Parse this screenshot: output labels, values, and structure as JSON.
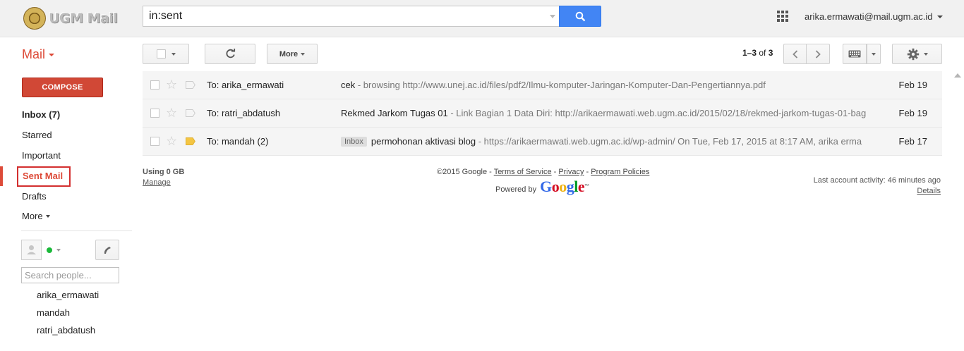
{
  "header": {
    "logo_text": "UGM Mail",
    "search_value": "in:sent",
    "account_email": "arika.ermawati@mail.ugm.ac.id"
  },
  "toolbar": {
    "mail_label": "Mail",
    "more_label": "More",
    "pager_range": "1–3",
    "pager_of": "of",
    "pager_total": "3"
  },
  "sidebar": {
    "compose_label": "COMPOSE",
    "items": [
      {
        "label": "Inbox (7)",
        "bold": true
      },
      {
        "label": "Starred"
      },
      {
        "label": "Important"
      },
      {
        "label": "Sent Mail",
        "active": true
      },
      {
        "label": "Drafts"
      },
      {
        "label": "More"
      }
    ],
    "people_search_placeholder": "Search people...",
    "contacts": [
      "arika_ermawati",
      "mandah",
      "ratri_abdatush"
    ]
  },
  "messages": [
    {
      "to": "To: arika_ermawati",
      "subject": "cek",
      "snippet": " - browsing http://www.unej.ac.id/files/pdf2/Ilmu-komputer-Jaringan-Komputer-Dan-Pengertiannya.pdf",
      "label": "",
      "date": "Feb 19",
      "important": false
    },
    {
      "to": "To: ratri_abdatush",
      "subject": "Rekmed Jarkom Tugas 01",
      "snippet": " - Link Bagian 1 Data Diri: http://arikaermawati.web.ugm.ac.id/2015/02/18/rekmed-jarkom-tugas-01-bag",
      "label": "",
      "date": "Feb 19",
      "important": false
    },
    {
      "to": "To: mandah (2)",
      "subject": "permohonan aktivasi blog",
      "snippet": " - https://arikaermawati.web.ugm.ac.id/wp-admin/ On Tue, Feb 17, 2015 at 8:17 AM, arika erma",
      "label": "Inbox",
      "date": "Feb 17",
      "important": true
    }
  ],
  "footer": {
    "usage": "Using 0 GB",
    "manage": "Manage",
    "copyright": "©2015 Google - ",
    "terms": "Terms of Service",
    "sep1": " - ",
    "privacy": "Privacy",
    "sep2": " - ",
    "policies": "Program Policies",
    "powered_by": "Powered by",
    "last_activity": "Last account activity: 46 minutes ago",
    "details": "Details"
  },
  "colors": {
    "accent_red": "#dd4b39",
    "compose_red": "#d14836",
    "search_blue": "#4285f4",
    "important_yellow": "#f4c542"
  }
}
